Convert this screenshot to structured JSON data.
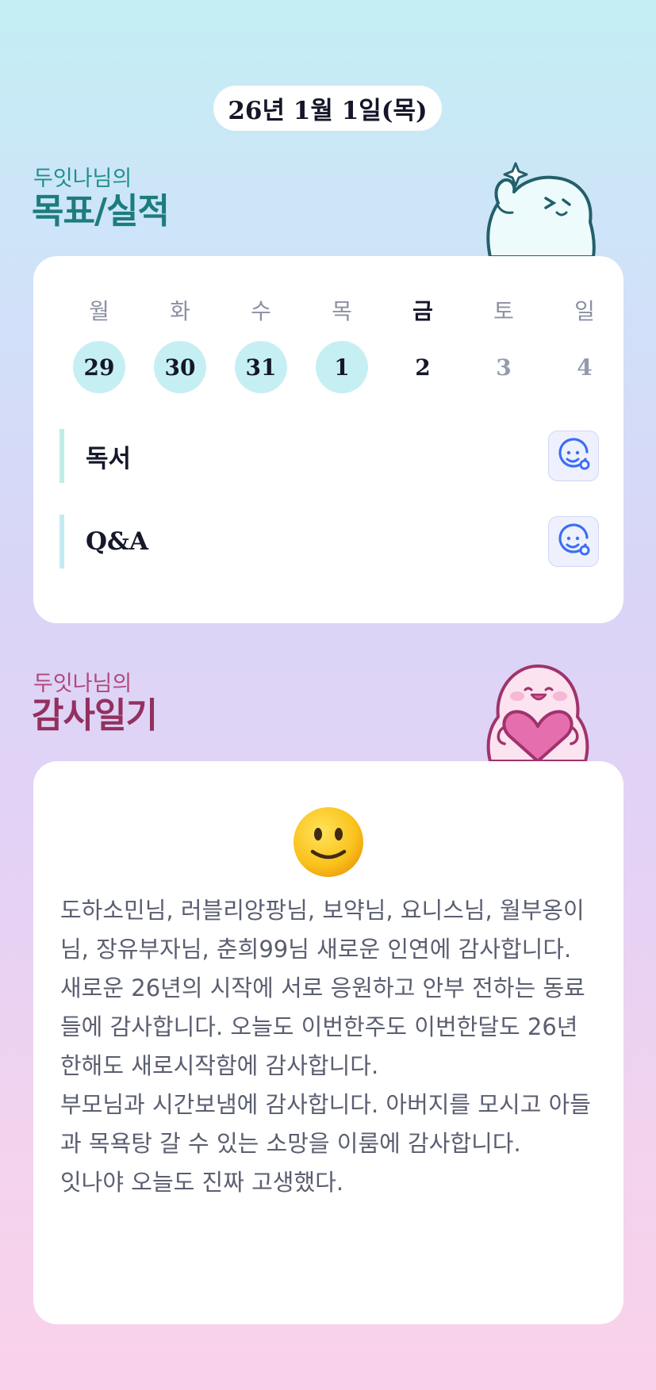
{
  "header": {
    "date": "26년 1월 1일(목)"
  },
  "goals": {
    "owner": "두잇나님의",
    "title": "목표/실적",
    "weekdays": [
      {
        "label": "월",
        "today": false
      },
      {
        "label": "화",
        "today": false
      },
      {
        "label": "수",
        "today": false
      },
      {
        "label": "목",
        "today": false
      },
      {
        "label": "금",
        "today": true
      },
      {
        "label": "토",
        "today": false
      },
      {
        "label": "일",
        "today": false
      }
    ],
    "dates": [
      {
        "day": "29",
        "state": "done"
      },
      {
        "day": "30",
        "state": "done"
      },
      {
        "day": "31",
        "state": "done"
      },
      {
        "day": "1",
        "state": "done"
      },
      {
        "day": "2",
        "state": "normal"
      },
      {
        "day": "3",
        "state": "future"
      },
      {
        "day": "4",
        "state": "future"
      }
    ],
    "items": [
      {
        "label": "독서",
        "icon": "mood-face-icon"
      },
      {
        "label": "Q&A",
        "icon": "mood-face-icon"
      }
    ]
  },
  "thanks": {
    "owner": "두잇나님의",
    "title": "감사일기",
    "mood_icon": "slightly-smiling-face-icon",
    "text": "도하소민님, 러블리앙팡님, 보약님, 요니스님, 월부옹이님, 장유부자님, 춘희99님 새로운 인연에 감사합니다.\n새로운 26년의 시작에 서로 응원하고 안부 전하는 동료들에 감사합니다. 오늘도 이번한주도 이번한달도 26년한해도 새로시작함에 감사합니다.\n부모님과 시간보냄에 감사합니다. 아버지를 모시고 아들과 목욕탕 갈 수 있는 소망을 이룸에 감사합니다.\n잇나야 오늘도 진짜 고생했다."
  },
  "colors": {
    "done_circle": "#c6eff3",
    "goal_title": "#1c7c7e",
    "thanks_title": "#93305f",
    "icon_blue": "#3b6ef5"
  }
}
